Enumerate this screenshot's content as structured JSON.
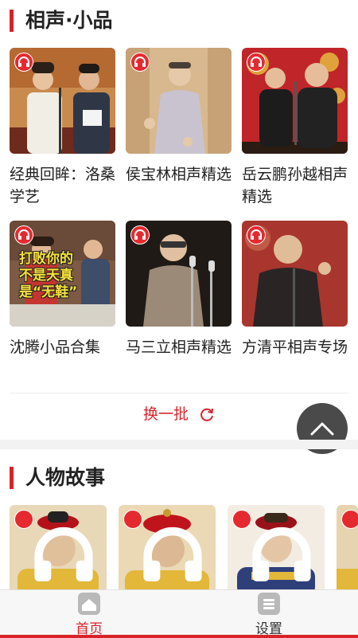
{
  "section1": {
    "title": "相声·小品",
    "items": [
      {
        "title": "经典回眸：洛桑学艺"
      },
      {
        "title": "侯宝林相声精选"
      },
      {
        "title": "岳云鹏孙越相声精选"
      },
      {
        "title": "沈腾小品合集"
      },
      {
        "title": "马三立相声精选"
      },
      {
        "title": "方清平相声专场"
      }
    ],
    "thumb4_caption": [
      "打败你的",
      "不是天真",
      "是“无鞋”"
    ],
    "refresh_label": "换一批"
  },
  "section2": {
    "title": "人物故事"
  },
  "tabbar": {
    "tabs": [
      {
        "label": "首页",
        "active": true
      },
      {
        "label": "设置",
        "active": false
      }
    ]
  },
  "colors": {
    "accent": "#d9232a",
    "badge": "#e52a2f",
    "scroll_top_bg": "#4a4a4a"
  },
  "icons": {
    "badge": "headphones-icon",
    "refresh": "refresh-icon",
    "scroll_top": "chevron-up-icon",
    "home": "home-icon",
    "settings": "settings-icon"
  }
}
